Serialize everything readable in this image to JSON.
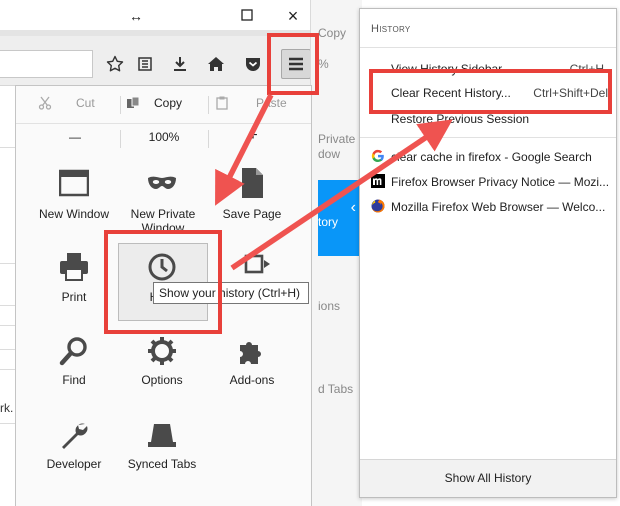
{
  "window": {
    "restore_label": "↔",
    "maximize_label": "□",
    "close_label": "×"
  },
  "background_page": {
    "fragment_text": "rk."
  },
  "menu_strip": {
    "copy_fragment": "Copy",
    "percent_fragment": "%",
    "private_fragment": "Private",
    "window_fragment": "dow",
    "history_fragment": "tory",
    "options_fragment": "ions",
    "synced_fragment": "d Tabs"
  },
  "menu": {
    "edit": {
      "cut": "Cut",
      "copy": "Copy",
      "paste": "Paste"
    },
    "zoom": {
      "minus": "—",
      "level": "100%",
      "plus": "+"
    },
    "items": [
      {
        "label": "New Window"
      },
      {
        "label": "New Private Window"
      },
      {
        "label": "Save Page"
      },
      {
        "label": "Print"
      },
      {
        "label": "H"
      },
      {
        "label": ""
      },
      {
        "label": "Find"
      },
      {
        "label": "Options"
      },
      {
        "label": "Add-ons"
      },
      {
        "label": "Developer"
      },
      {
        "label": "Synced Tabs"
      }
    ],
    "tooltip": "Show your history (Ctrl+H)"
  },
  "history": {
    "heading": "History",
    "actions": [
      {
        "label": "View History Sidebar",
        "shortcut": "Ctrl+H"
      },
      {
        "label": "Clear Recent History...",
        "shortcut": "Ctrl+Shift+Del"
      },
      {
        "label": "Restore Previous Session",
        "shortcut": ""
      }
    ],
    "recent": [
      {
        "title": "clear cache in firefox - Google Search",
        "icon": "google-favicon"
      },
      {
        "title": "Firefox Browser Privacy Notice — Mozi...",
        "icon": "mozilla-favicon"
      },
      {
        "title": "Mozilla Firefox Web Browser — Welco...",
        "icon": "firefox-favicon"
      }
    ],
    "footer": "Show All History"
  },
  "colors": {
    "highlight_red": "#e8403a",
    "accent_blue": "#0996f8",
    "icon_gray": "#4a4a4a"
  }
}
